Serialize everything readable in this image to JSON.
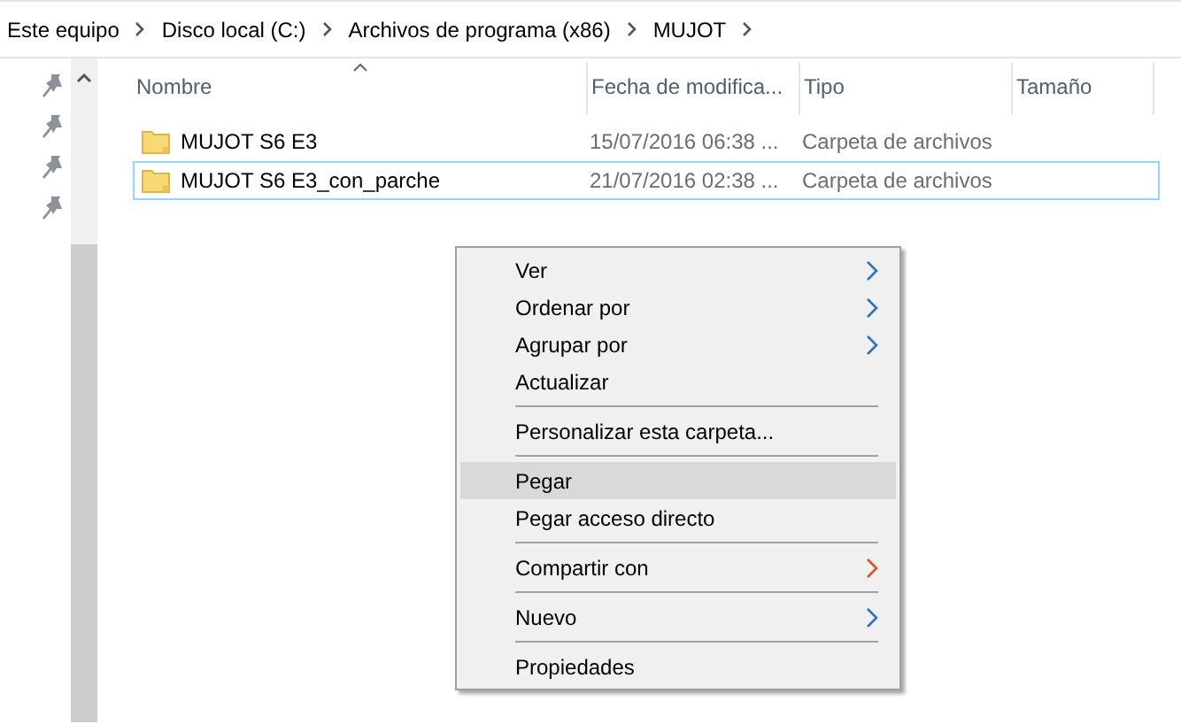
{
  "breadcrumb": [
    "Este equipo",
    "Disco local (C:)",
    "Archivos de programa (x86)",
    "MUJOT"
  ],
  "columns": [
    {
      "label": "Nombre",
      "sorted": true
    },
    {
      "label": "Fecha de modifica...",
      "sorted": false
    },
    {
      "label": "Tipo",
      "sorted": false
    },
    {
      "label": "Tamaño",
      "sorted": false
    }
  ],
  "rows": [
    {
      "name": "MUJOT S6 E3",
      "date": "15/07/2016 06:38 ...",
      "type": "Carpeta de archivos",
      "selected": false
    },
    {
      "name": "MUJOT S6 E3_con_parche",
      "date": "21/07/2016 02:38 ...",
      "type": "Carpeta de archivos",
      "selected": true
    }
  ],
  "context_menu": [
    {
      "kind": "item",
      "label": "Ver",
      "submenu": true,
      "color": "#2a6fc9",
      "selected": false
    },
    {
      "kind": "item",
      "label": "Ordenar por",
      "submenu": true,
      "color": "#2a6fc9",
      "selected": false
    },
    {
      "kind": "item",
      "label": "Agrupar por",
      "submenu": true,
      "color": "#2a6fc9",
      "selected": false
    },
    {
      "kind": "item",
      "label": "Actualizar",
      "submenu": false,
      "selected": false
    },
    {
      "kind": "separator"
    },
    {
      "kind": "item",
      "label": "Personalizar esta carpeta...",
      "submenu": false,
      "selected": false
    },
    {
      "kind": "separator"
    },
    {
      "kind": "item",
      "label": "Pegar",
      "submenu": false,
      "selected": true
    },
    {
      "kind": "item",
      "label": "Pegar acceso directo",
      "submenu": false,
      "selected": false
    },
    {
      "kind": "separator"
    },
    {
      "kind": "item",
      "label": "Compartir con",
      "submenu": true,
      "color": "#d9541e",
      "selected": false
    },
    {
      "kind": "separator"
    },
    {
      "kind": "item",
      "label": "Nuevo",
      "submenu": true,
      "color": "#2a6fc9",
      "selected": false
    },
    {
      "kind": "separator"
    },
    {
      "kind": "item",
      "label": "Propiedades",
      "submenu": false,
      "selected": false
    }
  ]
}
